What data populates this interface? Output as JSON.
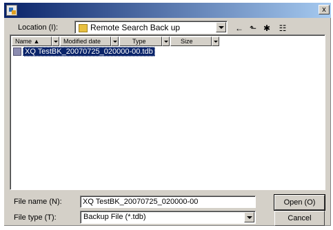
{
  "titlebar": {
    "close_label": "x"
  },
  "location": {
    "label": "Location (I):",
    "value": "Remote Search Back up"
  },
  "toolbar": {
    "back_glyph": "←",
    "up_glyph": "⬑",
    "new_folder_glyph": "✱",
    "view_glyph": "☷"
  },
  "columns": [
    "Name ▲",
    "Modified date",
    "Type",
    "Size"
  ],
  "files": [
    {
      "name": "XQ TestBK_20070725_020000-00.tdb"
    }
  ],
  "filename": {
    "label": "File name (N):",
    "value": "XQ TestBK_20070725_020000-00"
  },
  "filetype": {
    "label": "File type (T):",
    "value": "Backup File (*.tdb)"
  },
  "buttons": {
    "open": "Open (O)",
    "cancel": "Cancel"
  },
  "colors": {
    "selection": "#0a246a",
    "dialog_bg": "#d4d0c8"
  }
}
